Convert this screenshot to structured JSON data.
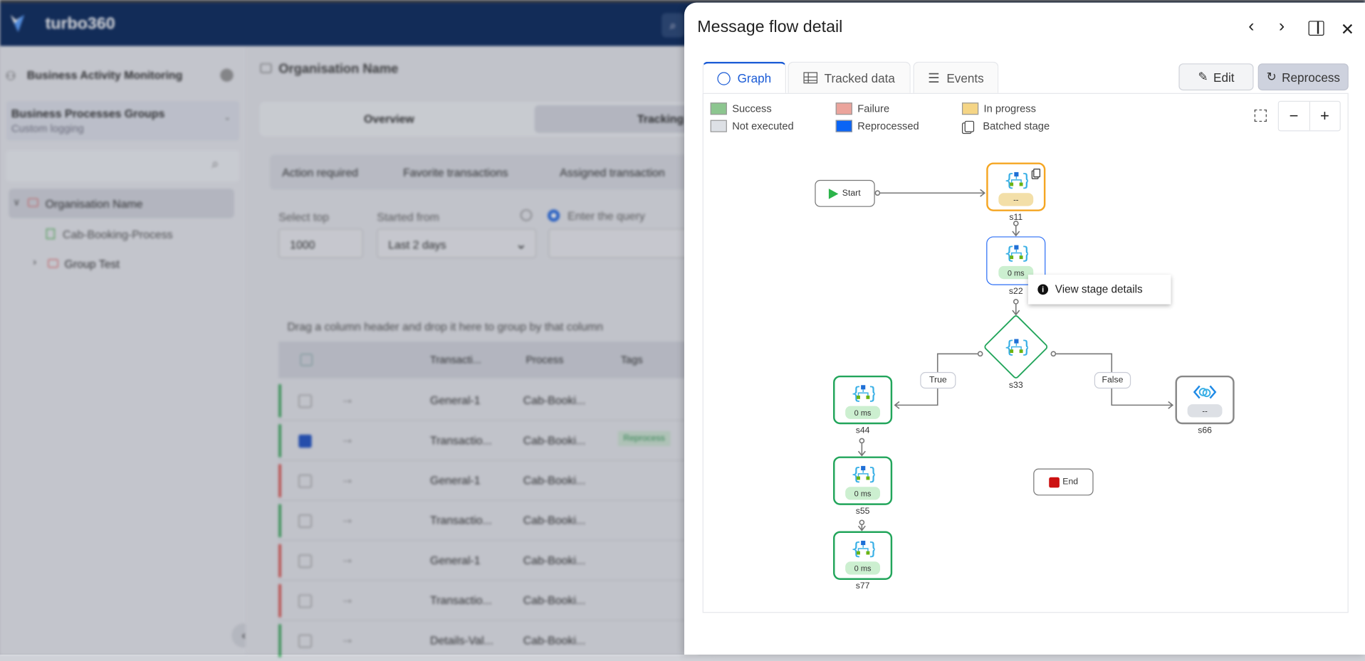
{
  "background": {
    "brand": "turbo360",
    "sidebar": {
      "title": "Business Activity Monitoring",
      "group_select": {
        "title": "Business Processes Groups",
        "subtitle": "Custom logging"
      },
      "tree": [
        {
          "label": "Organisation Name",
          "expanded": true,
          "selected": true
        },
        {
          "label": "Cab-Booking-Process"
        },
        {
          "label": "Group Test",
          "expanded": false
        }
      ]
    },
    "main": {
      "breadcrumb": "Organisation Name",
      "tabs": [
        "Overview",
        "Tracking"
      ],
      "subtabs": [
        "Action required",
        "Favorite transactions",
        "Assigned transaction"
      ],
      "filters": {
        "select_top_label": "Select top",
        "select_top_value": "1000",
        "started_from_label": "Started from",
        "started_from_value": "Last 2 days",
        "query_label": "Enter the query"
      },
      "group_hint": "Drag a column header and drop it here to group by that column",
      "columns": [
        "Transacti...",
        "Process",
        "Tags"
      ],
      "rows": [
        {
          "status": "success",
          "transaction": "General-1",
          "process": "Cab-Booki...",
          "tag": "",
          "checked": false
        },
        {
          "status": "success",
          "transaction": "Transactio...",
          "process": "Cab-Booki...",
          "tag": "Reprocess",
          "checked": true
        },
        {
          "status": "failure",
          "transaction": "General-1",
          "process": "Cab-Booki...",
          "tag": "",
          "checked": false
        },
        {
          "status": "success",
          "transaction": "Transactio...",
          "process": "Cab-Booki...",
          "tag": "",
          "checked": false
        },
        {
          "status": "failure",
          "transaction": "General-1",
          "process": "Cab-Booki...",
          "tag": "",
          "checked": false
        },
        {
          "status": "failure",
          "transaction": "Transactio...",
          "process": "Cab-Booki...",
          "tag": "",
          "checked": false
        },
        {
          "status": "success",
          "transaction": "Details-Val...",
          "process": "Cab-Booki...",
          "tag": "",
          "checked": false
        }
      ]
    }
  },
  "panel": {
    "title": "Message flow detail",
    "tabs": [
      {
        "label": "Graph",
        "icon": "chart-pie-icon",
        "active": true
      },
      {
        "label": "Tracked data",
        "icon": "table-icon"
      },
      {
        "label": "Events",
        "icon": "list-icon"
      }
    ],
    "edit_label": "Edit",
    "reprocess_label": "Reprocess",
    "legend": [
      {
        "label": "Success",
        "color": "#8cc68f"
      },
      {
        "label": "Failure",
        "color": "#eba49c"
      },
      {
        "label": "In progress",
        "color": "#f5d585"
      },
      {
        "label": "Not executed",
        "color": "#dde0e5"
      },
      {
        "label": "Reprocessed",
        "color": "#0a64f5"
      },
      {
        "label": "Batched stage",
        "icon": "copy-icon"
      }
    ],
    "graph": {
      "start_label": "Start",
      "end_label": "End",
      "nodes": [
        {
          "id": "s11",
          "status": "In progress",
          "duration": "--",
          "batched": true
        },
        {
          "id": "s22",
          "status": "Reprocessed",
          "duration": "0 ms"
        },
        {
          "id": "s33",
          "status": "Success",
          "shape": "decision"
        },
        {
          "id": "s44",
          "status": "Success",
          "duration": "0 ms"
        },
        {
          "id": "s55",
          "status": "Success",
          "duration": "0 ms"
        },
        {
          "id": "s77",
          "status": "Success",
          "duration": "0 ms"
        },
        {
          "id": "s66",
          "status": "Not executed",
          "duration": "--"
        }
      ],
      "edge_labels": {
        "true": "True",
        "false": "False"
      },
      "context_menu": {
        "item": "View stage details"
      }
    },
    "colors": {
      "success": "#22a55b",
      "progress": "#f5a623",
      "reprocessed": "#2b6ef5",
      "not_executed": "#888888",
      "accent": "#1a5bd6"
    }
  }
}
